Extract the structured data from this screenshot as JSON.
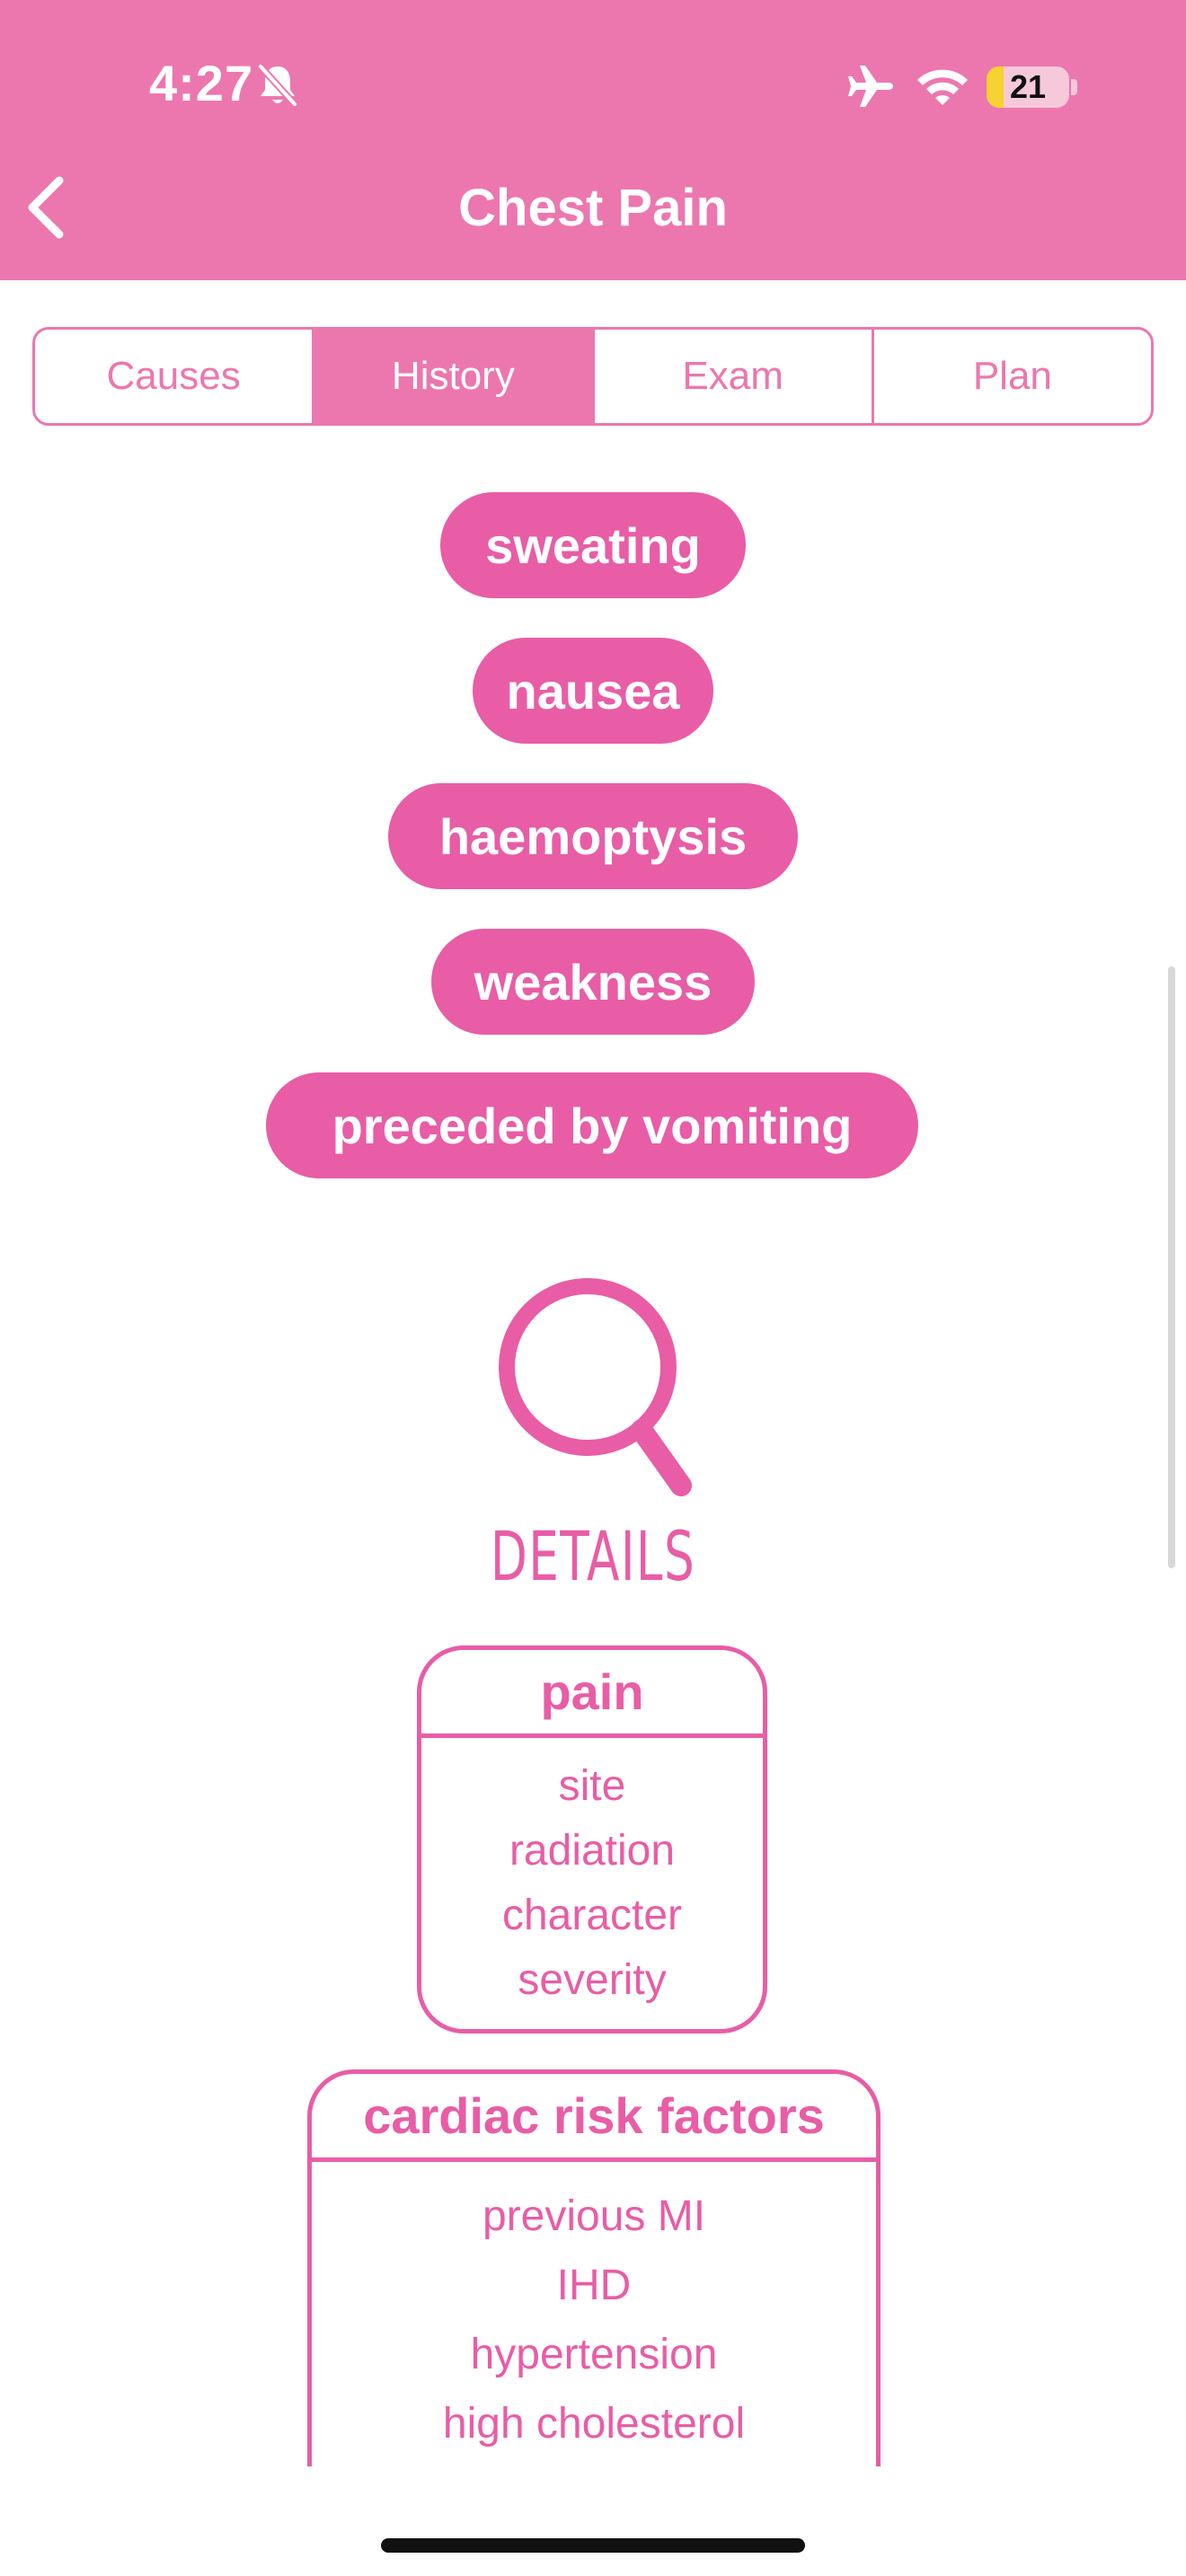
{
  "status_bar": {
    "time": "4:27",
    "battery_level": "21",
    "icons": [
      "bell-slash-icon",
      "airplane-icon",
      "wifi-icon",
      "battery-icon"
    ]
  },
  "nav": {
    "title": "Chest Pain",
    "back_icon": "chevron-left-icon"
  },
  "tabs": [
    {
      "label": "Causes",
      "active": false
    },
    {
      "label": "History",
      "active": true
    },
    {
      "label": "Exam",
      "active": false
    },
    {
      "label": "Plan",
      "active": false
    }
  ],
  "symptoms": [
    "sweating",
    "nausea",
    "haemoptysis",
    "weakness",
    "preceded by vomiting"
  ],
  "details": {
    "icon": "magnifier-icon",
    "title": "DETAILS",
    "cards": [
      {
        "title": "pain",
        "items": [
          "site",
          "radiation",
          "character",
          "severity"
        ]
      },
      {
        "title": "cardiac risk factors",
        "items": [
          "previous MI",
          "IHD",
          "hypertension",
          "high cholesterol"
        ]
      }
    ]
  },
  "colors": {
    "header": "#EC77AE",
    "accent": "#E85DA6",
    "background": "#FFFFFF"
  }
}
